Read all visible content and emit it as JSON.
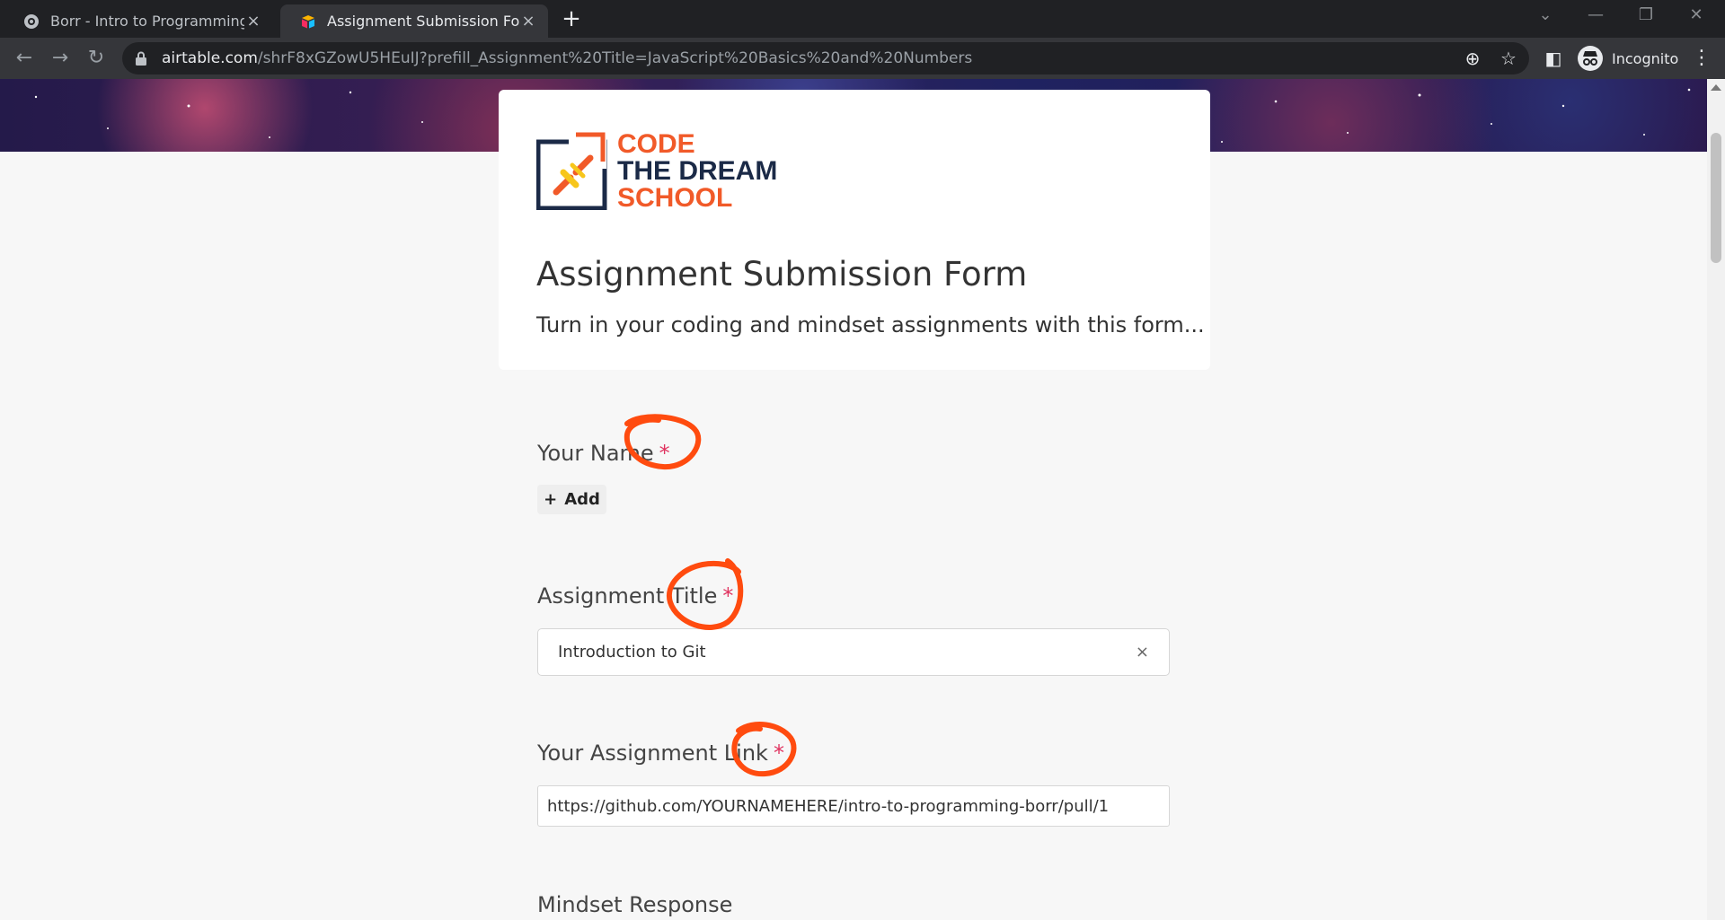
{
  "browser": {
    "tabs": [
      {
        "title": "Borr - Intro to Programming: Cur",
        "active": false
      },
      {
        "title": "Assignment Submission Form",
        "active": true
      }
    ],
    "new_tab": "+",
    "url_host": "airtable.com",
    "url_path": "/shrF8xGZowU5HEuIJ?prefill_Assignment%20Title=JavaScript%20Basics%20and%20Numbers",
    "incognito_label": "Incognito"
  },
  "logo": {
    "line1": "CODE",
    "line2": "THE DREAM",
    "line3": "SCHOOL",
    "colors": {
      "orange": "#f15a29",
      "navy": "#1b2a47",
      "yellow": "#f7c61b"
    }
  },
  "form": {
    "title": "Assignment Submission Form",
    "description": "Turn in your coding and mindset assignments with this form...",
    "fields": [
      {
        "label": "Your Name",
        "required": "*",
        "add_label": "Add"
      },
      {
        "label": "Assignment Title",
        "required": "*",
        "value": "Introduction to Git",
        "clear_icon": "×"
      },
      {
        "label": "Your Assignment Link",
        "required": "*",
        "value": "https://github.com/YOURNAMEHERE/intro-to-programming-borr/pull/1"
      },
      {
        "label": "Mindset Response"
      }
    ]
  },
  "colors": {
    "required": "#e0325f",
    "annotation": "#ff4b0f"
  }
}
